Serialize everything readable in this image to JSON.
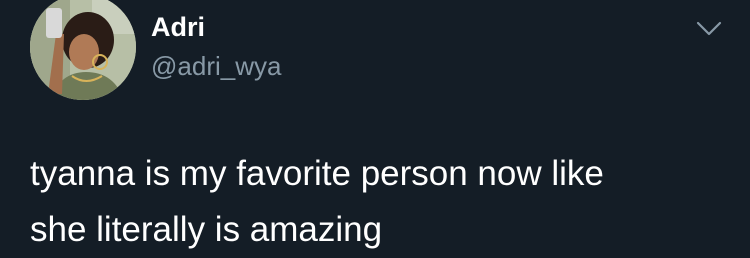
{
  "tweet": {
    "author": {
      "display_name": "Adri",
      "handle": "@adri_wya"
    },
    "text_lines": [
      "tyanna is my favorite person now like",
      "she literally is amazing"
    ]
  },
  "icons": {
    "more": "chevron-down-icon"
  },
  "colors": {
    "background": "#141d26",
    "name": "#ffffff",
    "handle": "#8899a6",
    "text": "#ffffff",
    "chevron": "#8899a6"
  }
}
